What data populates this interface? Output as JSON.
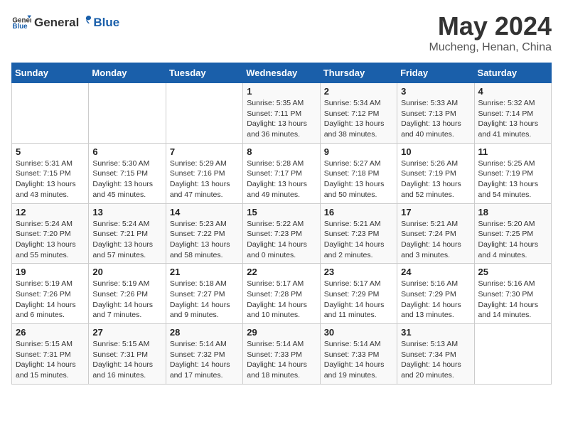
{
  "header": {
    "logo_general": "General",
    "logo_blue": "Blue",
    "title": "May 2024",
    "subtitle": "Mucheng, Henan, China"
  },
  "days_of_week": [
    "Sunday",
    "Monday",
    "Tuesday",
    "Wednesday",
    "Thursday",
    "Friday",
    "Saturday"
  ],
  "weeks": [
    [
      {
        "day": "",
        "info": ""
      },
      {
        "day": "",
        "info": ""
      },
      {
        "day": "",
        "info": ""
      },
      {
        "day": "1",
        "info": "Sunrise: 5:35 AM\nSunset: 7:11 PM\nDaylight: 13 hours\nand 36 minutes."
      },
      {
        "day": "2",
        "info": "Sunrise: 5:34 AM\nSunset: 7:12 PM\nDaylight: 13 hours\nand 38 minutes."
      },
      {
        "day": "3",
        "info": "Sunrise: 5:33 AM\nSunset: 7:13 PM\nDaylight: 13 hours\nand 40 minutes."
      },
      {
        "day": "4",
        "info": "Sunrise: 5:32 AM\nSunset: 7:14 PM\nDaylight: 13 hours\nand 41 minutes."
      }
    ],
    [
      {
        "day": "5",
        "info": "Sunrise: 5:31 AM\nSunset: 7:15 PM\nDaylight: 13 hours\nand 43 minutes."
      },
      {
        "day": "6",
        "info": "Sunrise: 5:30 AM\nSunset: 7:15 PM\nDaylight: 13 hours\nand 45 minutes."
      },
      {
        "day": "7",
        "info": "Sunrise: 5:29 AM\nSunset: 7:16 PM\nDaylight: 13 hours\nand 47 minutes."
      },
      {
        "day": "8",
        "info": "Sunrise: 5:28 AM\nSunset: 7:17 PM\nDaylight: 13 hours\nand 49 minutes."
      },
      {
        "day": "9",
        "info": "Sunrise: 5:27 AM\nSunset: 7:18 PM\nDaylight: 13 hours\nand 50 minutes."
      },
      {
        "day": "10",
        "info": "Sunrise: 5:26 AM\nSunset: 7:19 PM\nDaylight: 13 hours\nand 52 minutes."
      },
      {
        "day": "11",
        "info": "Sunrise: 5:25 AM\nSunset: 7:19 PM\nDaylight: 13 hours\nand 54 minutes."
      }
    ],
    [
      {
        "day": "12",
        "info": "Sunrise: 5:24 AM\nSunset: 7:20 PM\nDaylight: 13 hours\nand 55 minutes."
      },
      {
        "day": "13",
        "info": "Sunrise: 5:24 AM\nSunset: 7:21 PM\nDaylight: 13 hours\nand 57 minutes."
      },
      {
        "day": "14",
        "info": "Sunrise: 5:23 AM\nSunset: 7:22 PM\nDaylight: 13 hours\nand 58 minutes."
      },
      {
        "day": "15",
        "info": "Sunrise: 5:22 AM\nSunset: 7:23 PM\nDaylight: 14 hours\nand 0 minutes."
      },
      {
        "day": "16",
        "info": "Sunrise: 5:21 AM\nSunset: 7:23 PM\nDaylight: 14 hours\nand 2 minutes."
      },
      {
        "day": "17",
        "info": "Sunrise: 5:21 AM\nSunset: 7:24 PM\nDaylight: 14 hours\nand 3 minutes."
      },
      {
        "day": "18",
        "info": "Sunrise: 5:20 AM\nSunset: 7:25 PM\nDaylight: 14 hours\nand 4 minutes."
      }
    ],
    [
      {
        "day": "19",
        "info": "Sunrise: 5:19 AM\nSunset: 7:26 PM\nDaylight: 14 hours\nand 6 minutes."
      },
      {
        "day": "20",
        "info": "Sunrise: 5:19 AM\nSunset: 7:26 PM\nDaylight: 14 hours\nand 7 minutes."
      },
      {
        "day": "21",
        "info": "Sunrise: 5:18 AM\nSunset: 7:27 PM\nDaylight: 14 hours\nand 9 minutes."
      },
      {
        "day": "22",
        "info": "Sunrise: 5:17 AM\nSunset: 7:28 PM\nDaylight: 14 hours\nand 10 minutes."
      },
      {
        "day": "23",
        "info": "Sunrise: 5:17 AM\nSunset: 7:29 PM\nDaylight: 14 hours\nand 11 minutes."
      },
      {
        "day": "24",
        "info": "Sunrise: 5:16 AM\nSunset: 7:29 PM\nDaylight: 14 hours\nand 13 minutes."
      },
      {
        "day": "25",
        "info": "Sunrise: 5:16 AM\nSunset: 7:30 PM\nDaylight: 14 hours\nand 14 minutes."
      }
    ],
    [
      {
        "day": "26",
        "info": "Sunrise: 5:15 AM\nSunset: 7:31 PM\nDaylight: 14 hours\nand 15 minutes."
      },
      {
        "day": "27",
        "info": "Sunrise: 5:15 AM\nSunset: 7:31 PM\nDaylight: 14 hours\nand 16 minutes."
      },
      {
        "day": "28",
        "info": "Sunrise: 5:14 AM\nSunset: 7:32 PM\nDaylight: 14 hours\nand 17 minutes."
      },
      {
        "day": "29",
        "info": "Sunrise: 5:14 AM\nSunset: 7:33 PM\nDaylight: 14 hours\nand 18 minutes."
      },
      {
        "day": "30",
        "info": "Sunrise: 5:14 AM\nSunset: 7:33 PM\nDaylight: 14 hours\nand 19 minutes."
      },
      {
        "day": "31",
        "info": "Sunrise: 5:13 AM\nSunset: 7:34 PM\nDaylight: 14 hours\nand 20 minutes."
      },
      {
        "day": "",
        "info": ""
      }
    ]
  ]
}
